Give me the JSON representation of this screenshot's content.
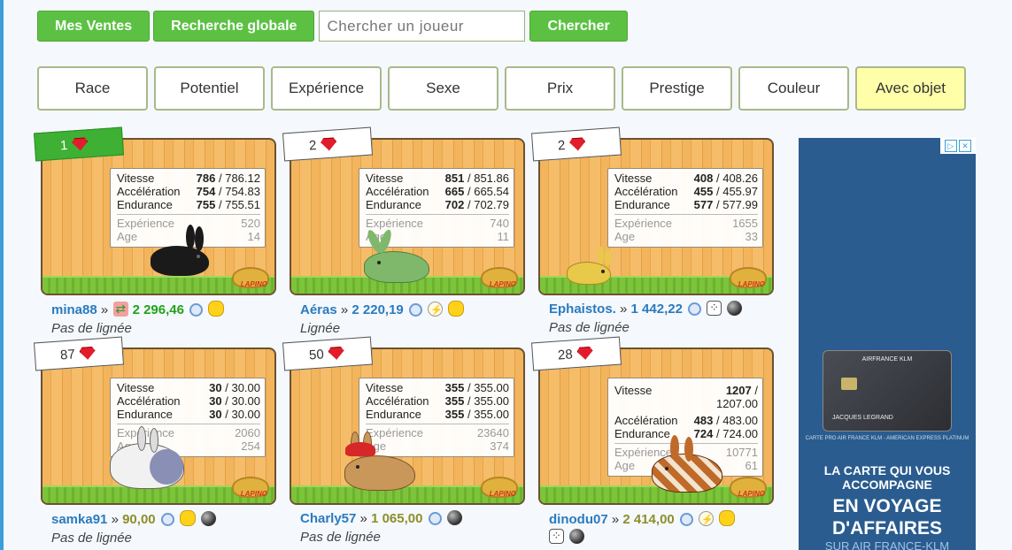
{
  "toolbar": {
    "my_sales": "Mes Ventes",
    "global_search": "Recherche globale",
    "search_placeholder": "Chercher un joueur",
    "search_button": "Chercher"
  },
  "filters": [
    "Race",
    "Potentiel",
    "Expérience",
    "Sexe",
    "Prix",
    "Prestige",
    "Couleur",
    "Avec objet"
  ],
  "labels": {
    "speed": "Vitesse",
    "acceleration": "Accélération",
    "endurance": "Endurance",
    "experience": "Expérience",
    "age": "Age",
    "bowl": "LAPINO",
    "chevron": "»"
  },
  "cards": [
    {
      "rank": "1",
      "speed": "786",
      "speed_max": "/ 786.12",
      "accel": "754",
      "accel_max": "/ 754.83",
      "endu": "755",
      "endu_max": "/ 755.51",
      "exp": "520",
      "age": "14",
      "owner": "mina88",
      "price": "2 296,46",
      "lineage": "Pas de lignée"
    },
    {
      "rank": "2",
      "speed": "851",
      "speed_max": "/ 851.86",
      "accel": "665",
      "accel_max": "/ 665.54",
      "endu": "702",
      "endu_max": "/ 702.79",
      "exp": "740",
      "age": "11",
      "owner": "Aéras",
      "price": "2 220,19",
      "lineage": "Lignée"
    },
    {
      "rank": "2",
      "speed": "408",
      "speed_max": "/ 408.26",
      "accel": "455",
      "accel_max": "/ 455.97",
      "endu": "577",
      "endu_max": "/ 577.99",
      "exp": "1655",
      "age": "33",
      "owner": "Ephaistos.",
      "price": "1 442,22",
      "lineage": "Pas de lignée"
    },
    {
      "rank": "87",
      "speed": "30",
      "speed_max": "/ 30.00",
      "accel": "30",
      "accel_max": "/ 30.00",
      "endu": "30",
      "endu_max": "/ 30.00",
      "exp": "2060",
      "age": "254",
      "owner": "samka91",
      "price": "90,00",
      "lineage": "Pas de lignée"
    },
    {
      "rank": "50",
      "speed": "355",
      "speed_max": "/ 355.00",
      "accel": "355",
      "accel_max": "/ 355.00",
      "endu": "355",
      "endu_max": "/ 355.00",
      "exp": "23640",
      "age": "374",
      "owner": "Charly57",
      "price": "1 065,00",
      "lineage": "Pas de lignée"
    },
    {
      "rank": "28",
      "speed": "1207",
      "speed_max": "/",
      "speed_max2": "1207.00",
      "accel": "483",
      "accel_max": "/ 483.00",
      "endu": "724",
      "endu_max": "/ 724.00",
      "exp": "10771",
      "age": "61",
      "owner": "dinodu07",
      "price": "2 414,00",
      "lineage": "Pas de lignée"
    }
  ],
  "ad": {
    "card_brand": "AIRFRANCE KLM",
    "card_holder": "JACQUES LEGRAND",
    "caption": "CARTE PRO AIR FRANCE KLM - AMERICAN EXPRESS PLATINUM",
    "headline": "LA CARTE QUI VOUS ACCOMPAGNE",
    "headline_big": "EN VOYAGE D'AFFAIRES",
    "footer": "SUR AIR FRANCE-KLM"
  },
  "colors": {
    "accent_green": "#5cc143",
    "link_blue": "#2a7bbf",
    "gem_red": "#e11d2c",
    "active_filter": "#ffffaa"
  }
}
